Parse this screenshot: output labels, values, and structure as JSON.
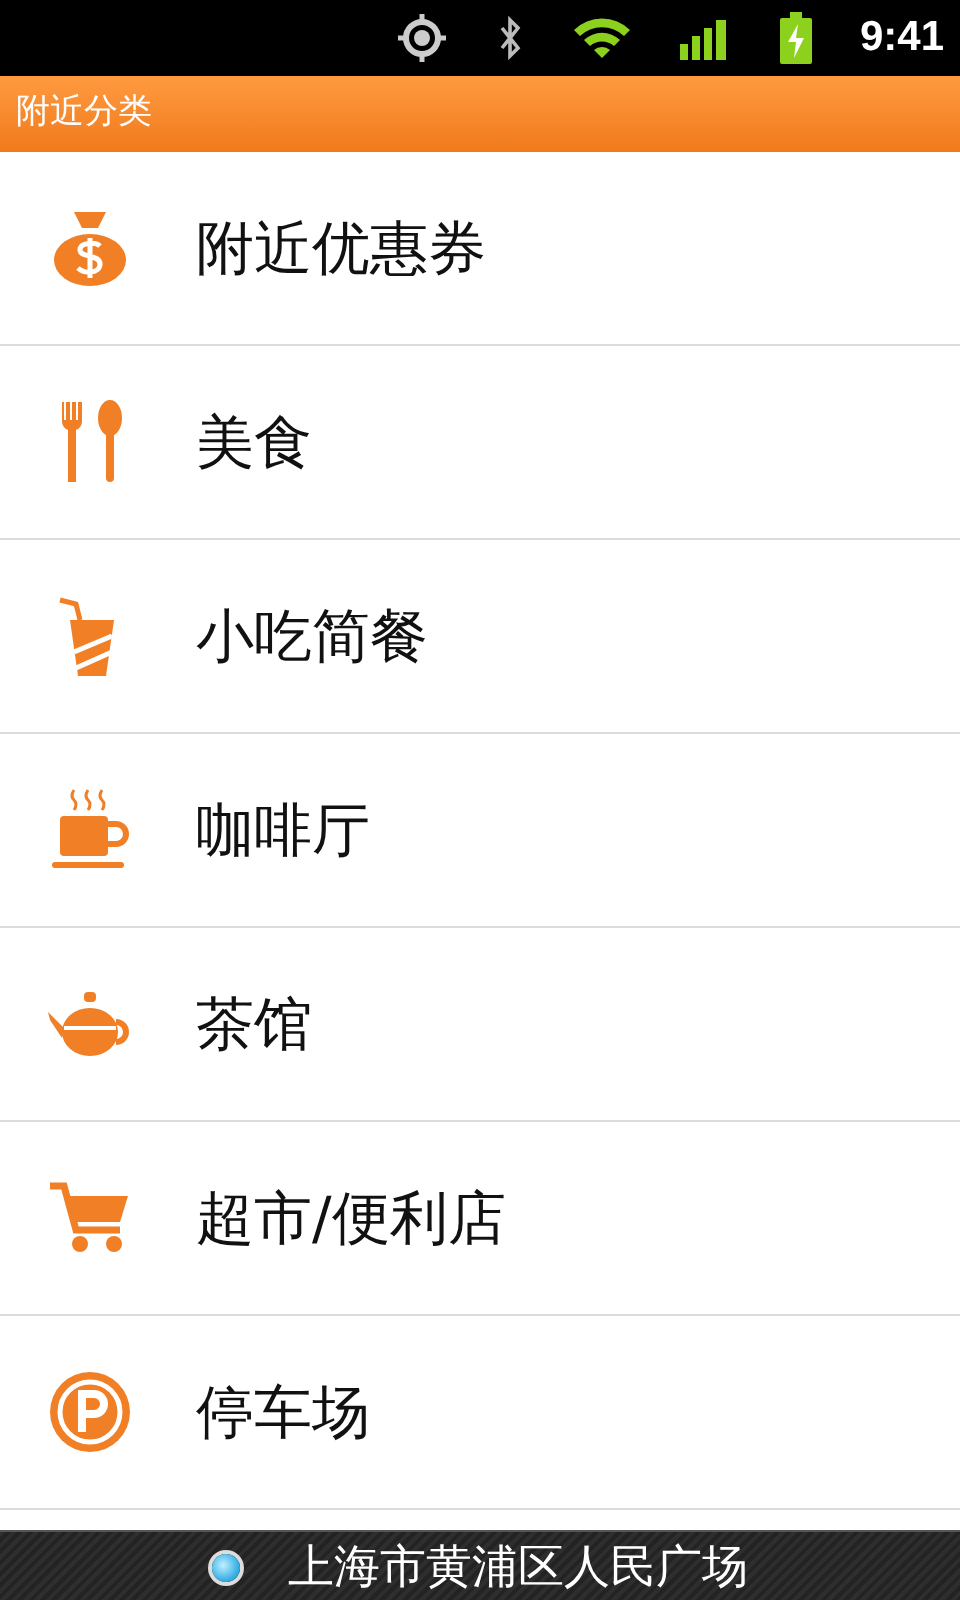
{
  "status_bar": {
    "time": "9:41"
  },
  "title_bar": {
    "title": "附近分类"
  },
  "categories": [
    {
      "label": "附近优惠券"
    },
    {
      "label": "美食"
    },
    {
      "label": "小吃简餐"
    },
    {
      "label": "咖啡厅"
    },
    {
      "label": "茶馆"
    },
    {
      "label": "超市/便利店"
    },
    {
      "label": "停车场"
    }
  ],
  "location_bar": {
    "location": "上海市黄浦区人民广场"
  }
}
